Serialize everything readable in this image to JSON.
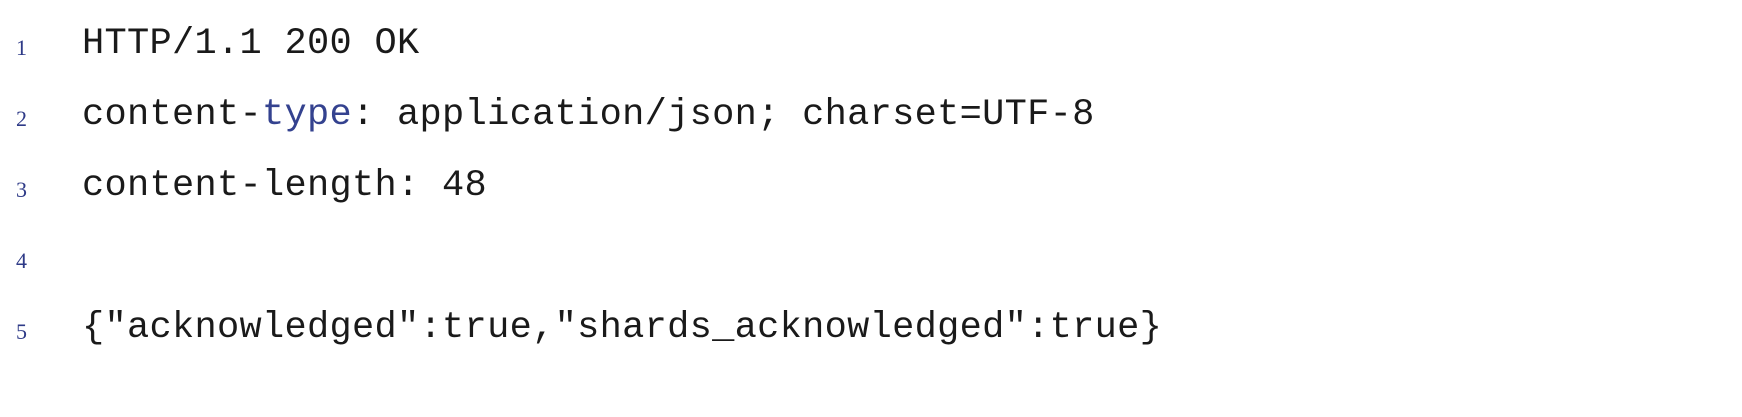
{
  "response": {
    "lines": [
      {
        "number": "1",
        "text": "HTTP/1.1 200 OK"
      },
      {
        "number": "2",
        "key_prefix": "content-",
        "key_keyword": "type",
        "rest": ": application/json; charset=UTF-8"
      },
      {
        "number": "3",
        "text": "content-length: 48"
      },
      {
        "number": "4",
        "text": ""
      },
      {
        "number": "5",
        "text": "{\"acknowledged\":true,\"shards_acknowledged\":true}"
      }
    ]
  },
  "colors": {
    "line_number": "#2e3a87",
    "text": "#1a1a1a",
    "keyword": "#34428f",
    "background": "#ffffff"
  }
}
